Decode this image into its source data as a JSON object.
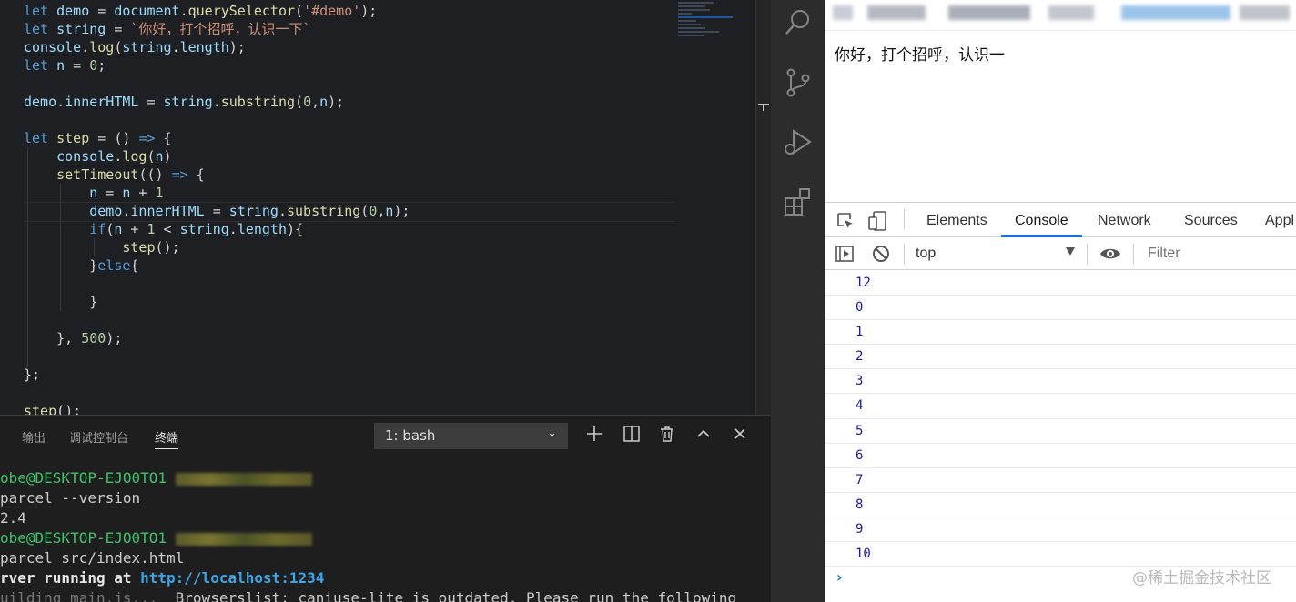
{
  "editor": {
    "lines": [
      [
        [
          "k",
          "let "
        ],
        [
          "v",
          "demo"
        ],
        [
          "p",
          " = "
        ],
        [
          "v",
          "document"
        ],
        [
          "p",
          "."
        ],
        [
          "f",
          "querySelector"
        ],
        [
          "p",
          "("
        ],
        [
          "s",
          "'#demo'"
        ],
        [
          "p",
          ");"
        ]
      ],
      [
        [
          "k",
          "let "
        ],
        [
          "v",
          "string"
        ],
        [
          "p",
          " = "
        ],
        [
          "s",
          "`你好，打个招呼，认识一下`"
        ]
      ],
      [
        [
          "v",
          "console"
        ],
        [
          "p",
          "."
        ],
        [
          "f",
          "log"
        ],
        [
          "p",
          "("
        ],
        [
          "v",
          "string"
        ],
        [
          "p",
          "."
        ],
        [
          "v",
          "length"
        ],
        [
          "p",
          ");"
        ]
      ],
      [
        [
          "k",
          "let "
        ],
        [
          "v",
          "n"
        ],
        [
          "p",
          " = "
        ],
        [
          "n",
          "0"
        ],
        [
          "p",
          ";"
        ]
      ],
      [],
      [
        [
          "v",
          "demo"
        ],
        [
          "p",
          "."
        ],
        [
          "v",
          "innerHTML"
        ],
        [
          "p",
          " = "
        ],
        [
          "v",
          "string"
        ],
        [
          "p",
          "."
        ],
        [
          "f",
          "substring"
        ],
        [
          "p",
          "("
        ],
        [
          "n",
          "0"
        ],
        [
          "p",
          ","
        ],
        [
          "v",
          "n"
        ],
        [
          "p",
          ");"
        ]
      ],
      [],
      [
        [
          "k",
          "let "
        ],
        [
          "f",
          "step"
        ],
        [
          "p",
          " = () "
        ],
        [
          "k",
          "=>"
        ],
        [
          "p",
          " {"
        ]
      ],
      [
        [
          "p",
          "    "
        ],
        [
          "v",
          "console"
        ],
        [
          "p",
          "."
        ],
        [
          "f",
          "log"
        ],
        [
          "p",
          "("
        ],
        [
          "v",
          "n"
        ],
        [
          "p",
          ")"
        ]
      ],
      [
        [
          "p",
          "    "
        ],
        [
          "f",
          "setTimeout"
        ],
        [
          "p",
          "(() "
        ],
        [
          "k",
          "=>"
        ],
        [
          "p",
          " {"
        ]
      ],
      [
        [
          "p",
          "        "
        ],
        [
          "v",
          "n"
        ],
        [
          "p",
          " = "
        ],
        [
          "v",
          "n"
        ],
        [
          "p",
          " + "
        ],
        [
          "n",
          "1"
        ]
      ],
      [
        [
          "p",
          "        "
        ],
        [
          "v",
          "demo"
        ],
        [
          "p",
          "."
        ],
        [
          "v",
          "innerHTML"
        ],
        [
          "p",
          " = "
        ],
        [
          "v",
          "string"
        ],
        [
          "p",
          "."
        ],
        [
          "f",
          "substring"
        ],
        [
          "p",
          "("
        ],
        [
          "n",
          "0"
        ],
        [
          "p",
          ","
        ],
        [
          "v",
          "n"
        ],
        [
          "p",
          ");"
        ]
      ],
      [
        [
          "p",
          "        "
        ],
        [
          "k",
          "if"
        ],
        [
          "p",
          "("
        ],
        [
          "v",
          "n"
        ],
        [
          "p",
          " + "
        ],
        [
          "n",
          "1"
        ],
        [
          "p",
          " < "
        ],
        [
          "v",
          "string"
        ],
        [
          "p",
          "."
        ],
        [
          "v",
          "length"
        ],
        [
          "p",
          "){"
        ]
      ],
      [
        [
          "p",
          "            "
        ],
        [
          "f",
          "step"
        ],
        [
          "p",
          "();"
        ]
      ],
      [
        [
          "p",
          "        "
        ],
        [
          "p",
          "}"
        ],
        [
          "k",
          "else"
        ],
        [
          "p",
          "{"
        ]
      ],
      [],
      [
        [
          "p",
          "        }"
        ]
      ],
      [],
      [
        [
          "p",
          "    }, "
        ],
        [
          "n",
          "500"
        ],
        [
          "p",
          ");"
        ]
      ],
      [],
      [
        [
          "p",
          "};"
        ]
      ],
      [],
      [
        [
          "f",
          "step"
        ],
        [
          "p",
          "();"
        ]
      ]
    ]
  },
  "panel": {
    "tabs": [
      "输出",
      "调试控制台",
      "终端"
    ],
    "active_tab": "终端",
    "terminal_select": "1: bash",
    "terminal_lines": [
      {
        "prefix": "obe@DESKTOP-EJO0TO1 ",
        "prefix_color": "green",
        "text": "",
        "blurred": true
      },
      {
        "text": "parcel --version"
      },
      {
        "text": "2.4"
      },
      {
        "prefix": "obe@DESKTOP-EJO0TO1 ",
        "prefix_color": "green",
        "text": "",
        "blurred": true
      },
      {
        "text": "parcel src/index.html"
      },
      {
        "bold": "rver running at ",
        "url": "http://localhost:1234"
      },
      {
        "dim": "uilding main.js...",
        "text": "  Browserslist: caniuse-lite is outdated. Please run the following"
      }
    ]
  },
  "browser": {
    "page_text": "你好，打个招呼，认识一"
  },
  "devtools": {
    "tabs": [
      "Elements",
      "Console",
      "Network",
      "Sources",
      "Appl"
    ],
    "active_tab": "Console",
    "context": "top",
    "filter_placeholder": "Filter",
    "console_lines": [
      "12",
      "0",
      "1",
      "2",
      "3",
      "4",
      "5",
      "6",
      "7",
      "8",
      "9",
      "10"
    ],
    "prompt": "›"
  },
  "watermark": "@稀土掘金技术社区"
}
